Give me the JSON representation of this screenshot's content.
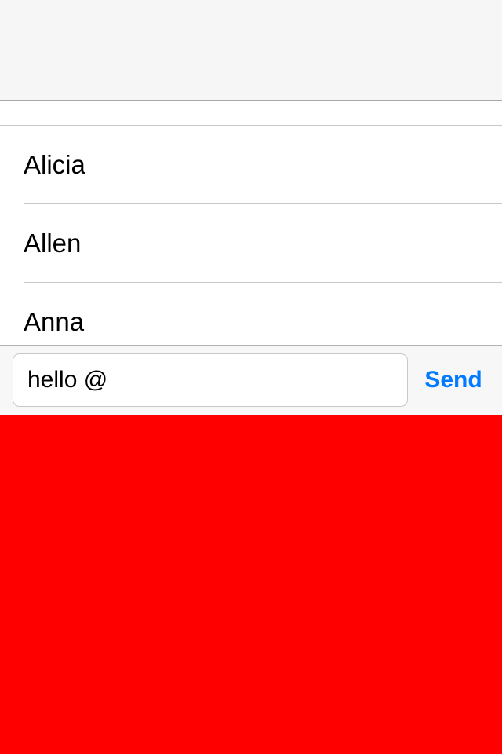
{
  "mention_list": {
    "items": [
      {
        "label": "Alicia"
      },
      {
        "label": "Allen"
      },
      {
        "label": "Anna"
      }
    ]
  },
  "composer": {
    "input_value": "hello @",
    "send_label": "Send"
  },
  "colors": {
    "accent": "#007aff",
    "keyboard_area": "#ff0000",
    "bar_background": "#f7f7f7"
  }
}
